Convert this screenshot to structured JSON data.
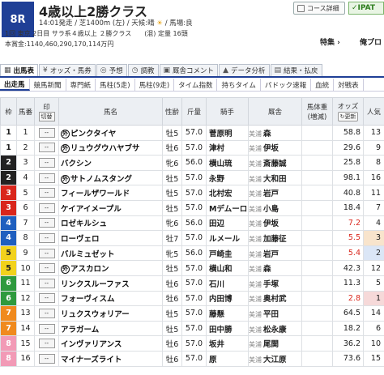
{
  "header": {
    "race_number": "8R",
    "title": "4歳以上2勝クラス",
    "info_line": "14:01発走 / 芝1400m (左) / 天候:晴",
    "weather_sun": "☀",
    "info_baba": " / 馬場:良",
    "info_line2": "1回 東京 2日目 サラ系４歳以上 ２勝クラス　　(混) 定量 16頭",
    "info_line3": "本賞金:1140,460,290,170,114万円",
    "course_button": "コース詳細",
    "ipat_label": "IPAT",
    "special_link": "特集",
    "fav_link": "俺プロ"
  },
  "tabs_main": [
    {
      "label": "出馬表",
      "icon": "▦",
      "active": true
    },
    {
      "label": "オッズ・馬券",
      "icon": "¥",
      "active": false
    },
    {
      "label": "予想",
      "icon": "◎",
      "active": false
    },
    {
      "label": "調教",
      "icon": "◷",
      "active": false
    },
    {
      "label": "厩舎コメント",
      "icon": "▣",
      "active": false
    },
    {
      "label": "データ分析",
      "icon": "▲",
      "active": false
    },
    {
      "label": "結果・払戻",
      "icon": "▤",
      "active": false
    }
  ],
  "tabs_sub": [
    {
      "label": "出走馬",
      "active": true
    },
    {
      "label": "競馬新聞",
      "active": false
    },
    {
      "label": "専門紙",
      "active": false
    },
    {
      "label": "馬柱(5走)",
      "active": false
    },
    {
      "label": "馬柱(9走)",
      "active": false
    },
    {
      "label": "タイム指数",
      "active": false
    },
    {
      "label": "持ちタイム",
      "active": false
    },
    {
      "label": "パドック速報",
      "active": false
    },
    {
      "label": "血統",
      "active": false
    },
    {
      "label": "対戦表",
      "active": false
    }
  ],
  "table": {
    "headers": {
      "waku": "枠",
      "umaban": "馬番",
      "mark": "印",
      "mark_toggle": "切替",
      "name": "馬名",
      "sex_age": "性齢",
      "weight": "斤量",
      "jockey": "騎手",
      "trainer": "厩舎",
      "body_weight": "馬体重(増減)",
      "odds": "オッズ",
      "odds_update": "更新",
      "popularity": "人気"
    },
    "rows": [
      {
        "waku": "1",
        "umaban": "1",
        "mark": "--",
        "maru": "外",
        "name": "ピンクタイヤ",
        "sex_age": "牡5",
        "weight": "57.0",
        "jockey": "菅原明",
        "area": "美浦",
        "trainer": "森",
        "odds": "58.8",
        "pop": "13"
      },
      {
        "waku": "1",
        "umaban": "2",
        "mark": "--",
        "maru": "外",
        "name": "リュウグウハヤブサ",
        "sex_age": "牡6",
        "weight": "57.0",
        "jockey": "津村",
        "area": "美浦",
        "trainer": "伊坂",
        "odds": "29.6",
        "pop": "9"
      },
      {
        "waku": "2",
        "umaban": "3",
        "mark": "--",
        "maru": "",
        "name": "バクシン",
        "sex_age": "牝6",
        "weight": "56.0",
        "jockey": "横山琉",
        "area": "美浦",
        "trainer": "斎藤誠",
        "odds": "25.8",
        "pop": "8"
      },
      {
        "waku": "2",
        "umaban": "4",
        "mark": "--",
        "maru": "外",
        "name": "サトノムスタング",
        "sex_age": "牡5",
        "weight": "57.0",
        "jockey": "永野",
        "area": "美浦",
        "trainer": "大和田",
        "odds": "98.1",
        "pop": "16"
      },
      {
        "waku": "3",
        "umaban": "5",
        "mark": "--",
        "maru": "",
        "name": "フィールザワールド",
        "sex_age": "牡5",
        "weight": "57.0",
        "jockey": "北村宏",
        "area": "美浦",
        "trainer": "岩戸",
        "odds": "40.8",
        "pop": "11"
      },
      {
        "waku": "3",
        "umaban": "6",
        "mark": "--",
        "maru": "",
        "name": "ケイアイメープル",
        "sex_age": "牡5",
        "weight": "57.0",
        "jockey": "Mデムーロ",
        "area": "美浦",
        "trainer": "小島",
        "odds": "18.4",
        "pop": "7"
      },
      {
        "waku": "4",
        "umaban": "7",
        "mark": "--",
        "maru": "",
        "name": "ロゼキルシュ",
        "sex_age": "牝6",
        "weight": "56.0",
        "jockey": "田辺",
        "area": "美浦",
        "trainer": "伊坂",
        "odds": "7.2",
        "pop": "4"
      },
      {
        "waku": "4",
        "umaban": "8",
        "mark": "--",
        "maru": "",
        "name": "ローヴェロ",
        "sex_age": "牡7",
        "weight": "57.0",
        "jockey": "ルメール",
        "area": "美浦",
        "trainer": "加藤征",
        "odds": "5.5",
        "pop": "3"
      },
      {
        "waku": "5",
        "umaban": "9",
        "mark": "--",
        "maru": "",
        "name": "バルミュゼット",
        "sex_age": "牝5",
        "weight": "56.0",
        "jockey": "戸崎圭",
        "area": "美浦",
        "trainer": "岩戸",
        "odds": "5.4",
        "pop": "2"
      },
      {
        "waku": "5",
        "umaban": "10",
        "mark": "--",
        "maru": "外",
        "name": "アスカロン",
        "sex_age": "牡5",
        "weight": "57.0",
        "jockey": "横山和",
        "area": "美浦",
        "trainer": "森",
        "odds": "42.3",
        "pop": "12"
      },
      {
        "waku": "6",
        "umaban": "11",
        "mark": "--",
        "maru": "",
        "name": "リンクスルーファス",
        "sex_age": "牡6",
        "weight": "57.0",
        "jockey": "石川",
        "area": "美浦",
        "trainer": "手塚",
        "odds": "11.3",
        "pop": "5"
      },
      {
        "waku": "6",
        "umaban": "12",
        "mark": "--",
        "maru": "",
        "name": "フォーヴィスム",
        "sex_age": "牡6",
        "weight": "57.0",
        "jockey": "内田博",
        "area": "美浦",
        "trainer": "奥村武",
        "odds": "2.8",
        "pop": "1"
      },
      {
        "waku": "7",
        "umaban": "13",
        "mark": "--",
        "maru": "",
        "name": "リュクスウォリアー",
        "sex_age": "牡5",
        "weight": "57.0",
        "jockey": "藤懸",
        "area": "美浦",
        "trainer": "平田",
        "odds": "64.5",
        "pop": "14"
      },
      {
        "waku": "7",
        "umaban": "14",
        "mark": "--",
        "maru": "",
        "name": "アラガーム",
        "sex_age": "牡5",
        "weight": "57.0",
        "jockey": "田中勝",
        "area": "美浦",
        "trainer": "松永康",
        "odds": "18.2",
        "pop": "6"
      },
      {
        "waku": "8",
        "umaban": "15",
        "mark": "--",
        "maru": "",
        "name": "インヴァリアンス",
        "sex_age": "牡6",
        "weight": "57.0",
        "jockey": "坂井",
        "area": "美浦",
        "trainer": "尾関",
        "odds": "36.2",
        "pop": "10"
      },
      {
        "waku": "8",
        "umaban": "16",
        "mark": "--",
        "maru": "",
        "name": "マイナーズライト",
        "sex_age": "牡6",
        "weight": "57.0",
        "jockey": "原",
        "area": "美浦",
        "trainer": "大江原",
        "odds": "73.6",
        "pop": "15"
      }
    ]
  },
  "colors": {
    "waku": {
      "1": "#ffffff",
      "2": "#222222",
      "3": "#d9261c",
      "4": "#1f5fbf",
      "5": "#f2d21c",
      "6": "#2e9a3e",
      "7": "#f08a1e",
      "8": "#f29ab6"
    },
    "waku_text": {
      "1": "#222222",
      "2": "#ffffff",
      "3": "#ffffff",
      "4": "#ffffff",
      "5": "#222222",
      "6": "#ffffff",
      "7": "#ffffff",
      "8": "#ffffff"
    },
    "pop_bg": {
      "1": "#f6d9d9",
      "2": "#dbe6f6",
      "3": "#f8e4cc"
    },
    "odds_highlight": "#d9261c"
  }
}
